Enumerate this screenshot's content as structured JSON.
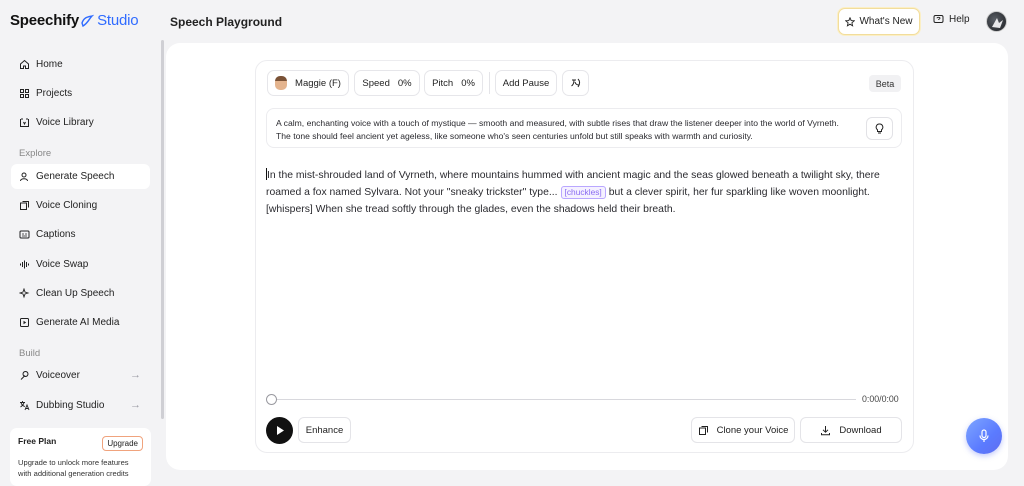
{
  "app": {
    "brand": "Speechify",
    "product": "Studio",
    "page_title": "Speech Playground",
    "accent_color": "#2f6bff"
  },
  "topbar": {
    "whats_new_label": "What's New",
    "help_label": "Help"
  },
  "sidebar": {
    "items": [
      {
        "label": "Home",
        "icon": "home-icon"
      },
      {
        "label": "Projects",
        "icon": "grid-icon"
      },
      {
        "label": "Voice Library",
        "icon": "library-icon"
      }
    ],
    "explore_heading": "Explore",
    "explore_items": [
      {
        "label": "Generate Speech",
        "icon": "speech-icon",
        "active": true
      },
      {
        "label": "Voice Cloning",
        "icon": "clone-icon"
      },
      {
        "label": "Captions",
        "icon": "captions-icon"
      },
      {
        "label": "Voice Swap",
        "icon": "waveform-icon"
      },
      {
        "label": "Clean Up Speech",
        "icon": "sparkle-icon"
      },
      {
        "label": "Generate AI Media",
        "icon": "media-icon"
      }
    ],
    "build_heading": "Build",
    "build_items": [
      {
        "label": "Voiceover",
        "icon": "voiceover-icon"
      },
      {
        "label": "Dubbing Studio",
        "icon": "translate-icon"
      }
    ],
    "plan": {
      "title": "Free Plan",
      "upgrade_label": "Upgrade",
      "description": "Upgrade to unlock more features with additional generation credits"
    }
  },
  "controls": {
    "voice_label": "Maggie (F)",
    "speed_label": "Speed",
    "speed_value": "0%",
    "pitch_label": "Pitch",
    "pitch_value": "0%",
    "add_pause_label": "Add Pause",
    "beta_label": "Beta"
  },
  "prompt": {
    "text": "A calm, enchanting voice with a touch of mystique — smooth and measured, with subtle rises that draw the listener deeper into the world of Vyrneth. The tone should feel ancient yet ageless, like someone who's seen centuries unfold but still speaks with warmth and curiosity."
  },
  "editor": {
    "part1": "In the mist-shrouded land of Vyrneth, where mountains hummed with ancient magic and the seas glowed beneath a twilight sky, there roamed a fox named Sylvara. Not your \"sneaky trickster\" type...",
    "tag": "[chuckles]",
    "part2": "but a clever spirit, her fur sparkling like woven moonlight. [whispers] When she tread softly through the glades, even the shadows held their breath."
  },
  "player": {
    "time": "0:00/0:00",
    "progress": 0,
    "enhance_label": "Enhance",
    "clone_label": "Clone your Voice",
    "download_label": "Download"
  }
}
